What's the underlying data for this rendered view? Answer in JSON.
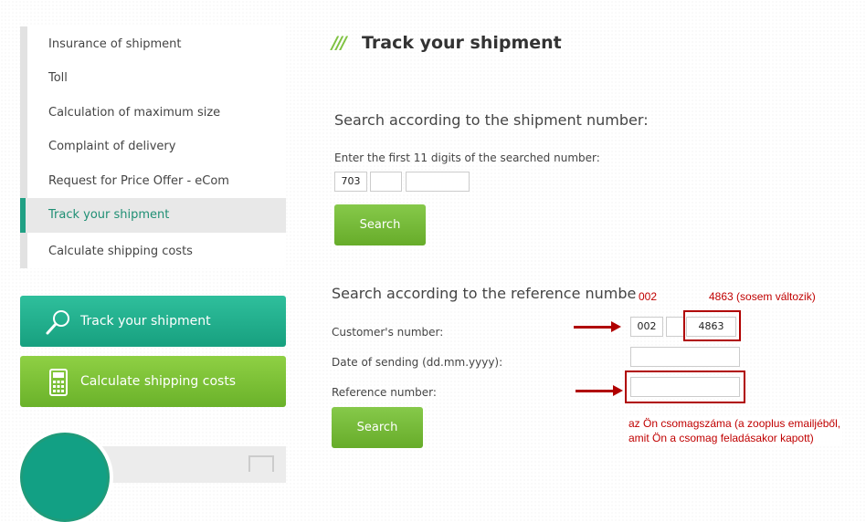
{
  "sidebar": {
    "items": [
      {
        "label": "Insurance of shipment"
      },
      {
        "label": "Toll"
      },
      {
        "label": "Calculation of maximum size"
      },
      {
        "label": "Complaint of delivery"
      },
      {
        "label": "Request for Price Offer - eCom"
      },
      {
        "label": "Track your shipment",
        "active": true
      },
      {
        "label": "Calculate shipping costs"
      }
    ]
  },
  "promo": {
    "track_label": "Track your shipment",
    "track_icon": "magnifier-icon",
    "calc_label": "Calculate shipping costs",
    "calc_icon": "calculator-icon"
  },
  "main": {
    "slashes": "///",
    "title": "Track your shipment",
    "shipment_search": {
      "heading": "Search according to the shipment number:",
      "hint": "Enter the first 11 digits of the searched number:",
      "field1": "703",
      "field2": "",
      "field3": "",
      "button": "Search"
    },
    "reference_search": {
      "heading": "Search according to the reference number:",
      "customer_label": "Customer's number:",
      "customer_field1": "002",
      "customer_field2": "",
      "customer_field3": "4863",
      "date_label": "Date of sending (dd.mm.yyyy):",
      "date_value": "",
      "reference_label": "Reference number:",
      "reference_value": "",
      "button": "Search"
    }
  },
  "annotations": {
    "code1": "002",
    "code2": "4863 (sosem változik)",
    "note_line1": "az Ön csomagszáma (a zooplus emailjéből,",
    "note_line2": "amit Ön a csomag feladásakor kapott)"
  },
  "colors": {
    "accent_green": "#7fc241",
    "teal": "#1aa584",
    "annotation_red": "#c00000"
  }
}
